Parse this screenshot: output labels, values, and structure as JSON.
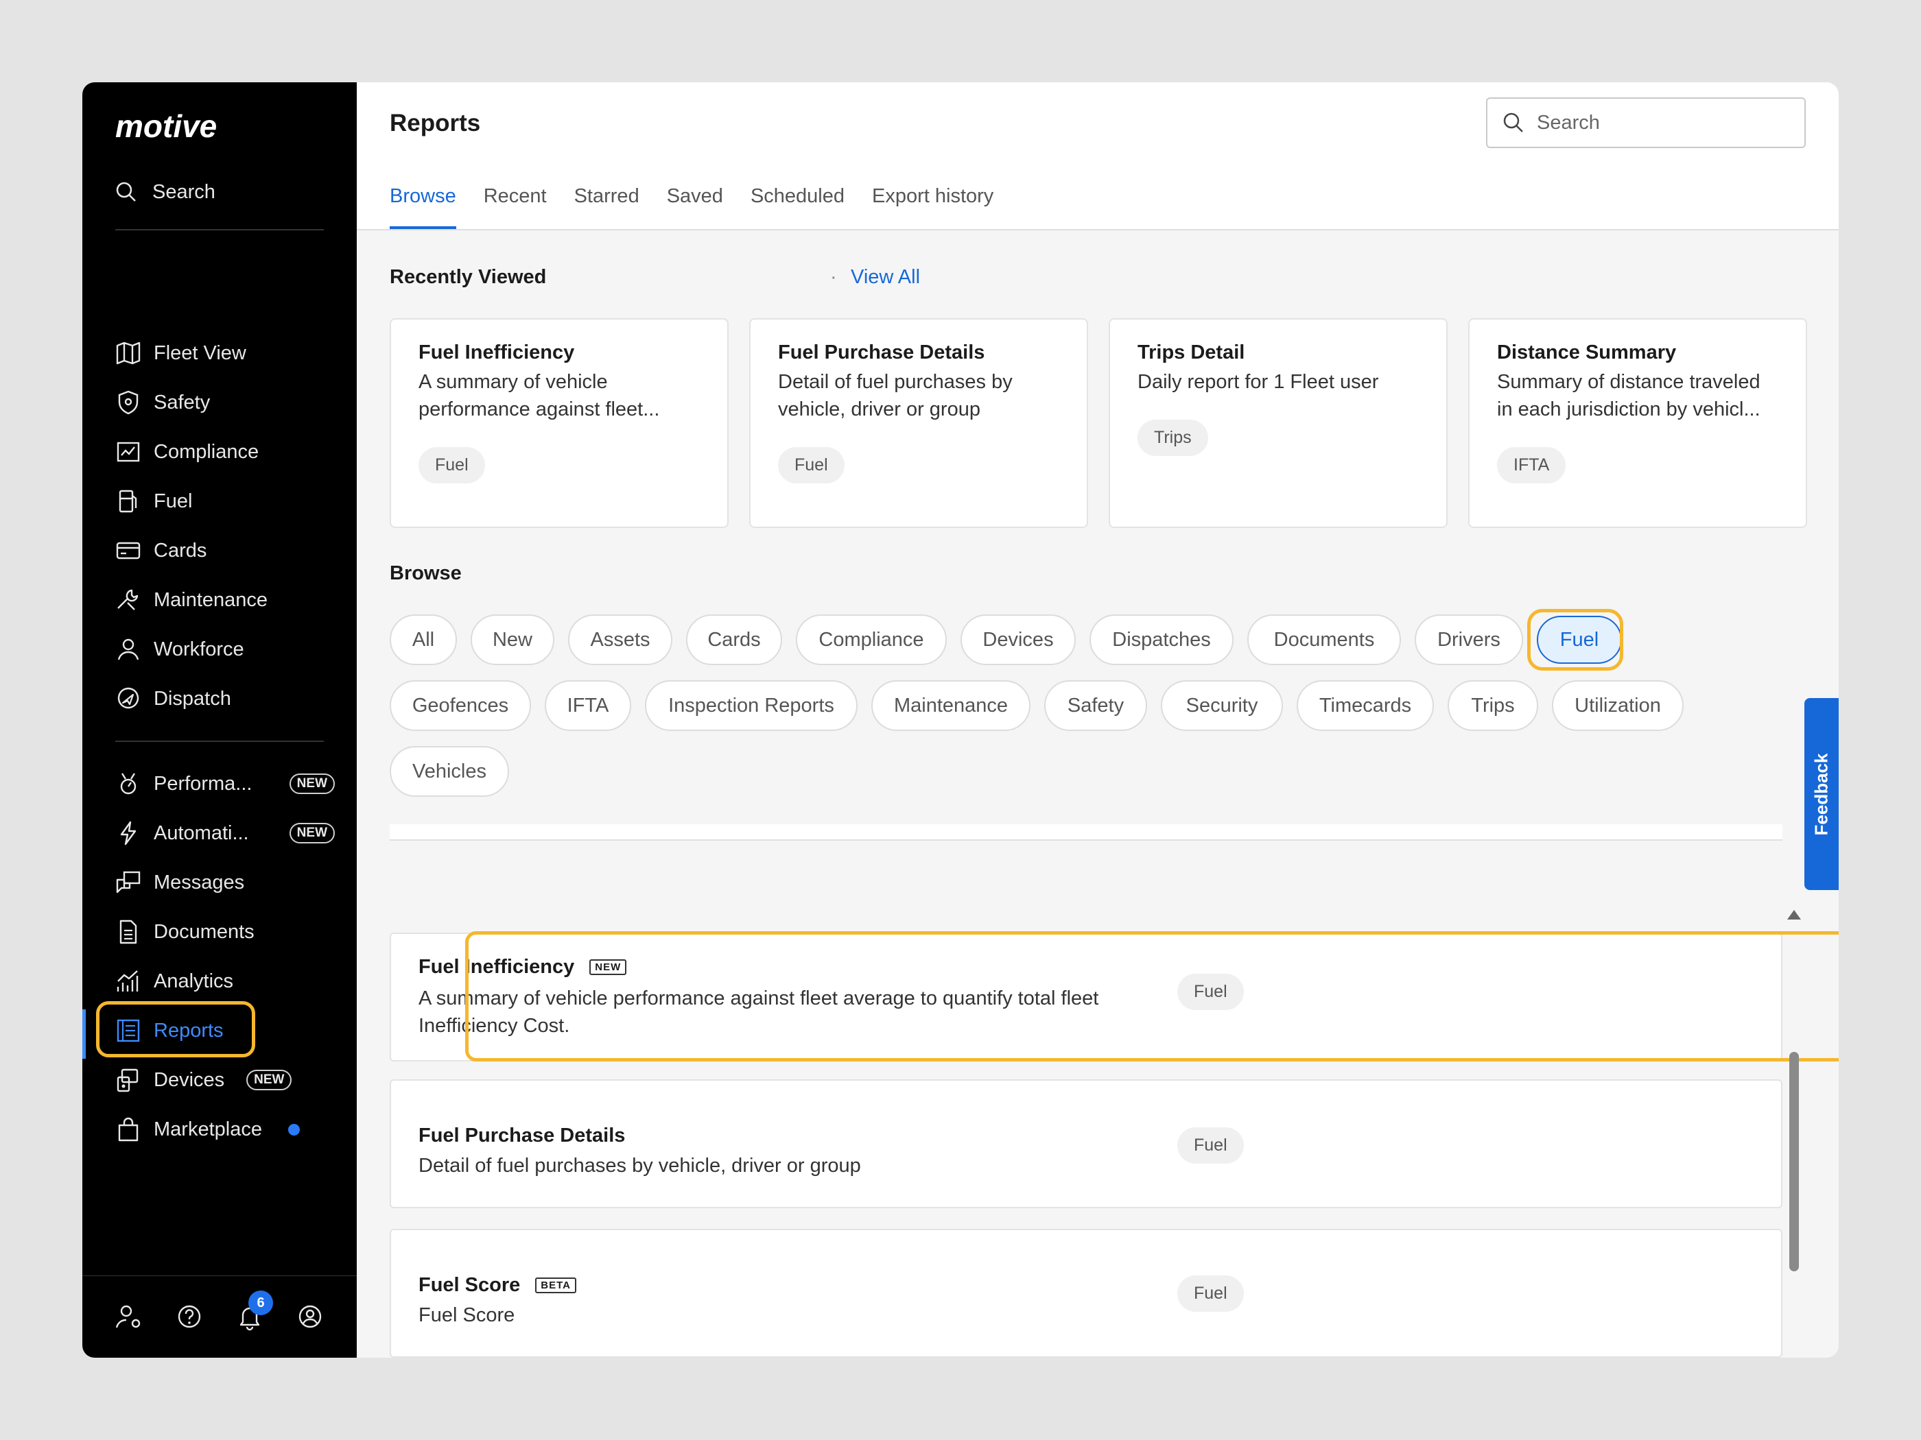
{
  "sidebar": {
    "logo": "motive",
    "search_label": "Search",
    "items": [
      {
        "label": "Fleet View"
      },
      {
        "label": "Safety"
      },
      {
        "label": "Compliance"
      },
      {
        "label": "Fuel"
      },
      {
        "label": "Cards"
      },
      {
        "label": "Maintenance"
      },
      {
        "label": "Workforce"
      },
      {
        "label": "Dispatch"
      },
      {
        "label": "Performa...",
        "badge": "NEW"
      },
      {
        "label": "Automati...",
        "badge": "NEW"
      },
      {
        "label": "Messages"
      },
      {
        "label": "Documents"
      },
      {
        "label": "Analytics"
      },
      {
        "label": "Reports"
      },
      {
        "label": "Devices",
        "badge": "NEW"
      },
      {
        "label": "Marketplace"
      }
    ],
    "notification_count": "6"
  },
  "header": {
    "title": "Reports",
    "search_placeholder": "Search",
    "tabs": [
      "Browse",
      "Recent",
      "Starred",
      "Saved",
      "Scheduled",
      "Export history"
    ]
  },
  "recent": {
    "title": "Recently Viewed",
    "view_all": "View All",
    "cards": [
      {
        "title": "Fuel Inefficiency",
        "desc1": "A summary of vehicle",
        "desc2": "performance against fleet...",
        "tag": "Fuel"
      },
      {
        "title": "Fuel Purchase Details",
        "desc1": "Detail of fuel purchases by",
        "desc2": "vehicle, driver or group",
        "tag": "Fuel"
      },
      {
        "title": "Trips Detail",
        "desc1": "Daily report for 1 Fleet user",
        "desc2": "",
        "tag": "Trips"
      },
      {
        "title": "Distance Summary",
        "desc1": "Summary of distance traveled",
        "desc2": "in each jurisdiction by vehicl...",
        "tag": "IFTA"
      }
    ]
  },
  "browse": {
    "title": "Browse",
    "chips": [
      "All",
      "New",
      "Assets",
      "Cards",
      "Compliance",
      "Devices",
      "Dispatches",
      "Documents",
      "Drivers",
      "Fuel",
      "Geofences",
      "IFTA",
      "Inspection Reports",
      "Maintenance",
      "Safety",
      "Security",
      "Timecards",
      "Trips",
      "Utilization",
      "Vehicles"
    ],
    "selected_chip": "Fuel"
  },
  "reports": [
    {
      "title": "Fuel Inefficiency",
      "badge": "NEW",
      "desc1": "A summary of vehicle performance against fleet average to quantify total fleet",
      "desc2": "Inefficiency Cost.",
      "tag": "Fuel"
    },
    {
      "title": "Fuel Purchase Details",
      "badge": "",
      "desc1": "Detail of fuel purchases by vehicle, driver or group",
      "desc2": "",
      "tag": "Fuel"
    },
    {
      "title": "Fuel Score",
      "badge": "BETA",
      "desc1": "Fuel Score",
      "desc2": "",
      "tag": "Fuel"
    }
  ],
  "feedback_label": "Feedback",
  "colors": {
    "accent": "#1668d8",
    "highlight": "#f5b72d",
    "sidebar_bg": "#000000"
  }
}
